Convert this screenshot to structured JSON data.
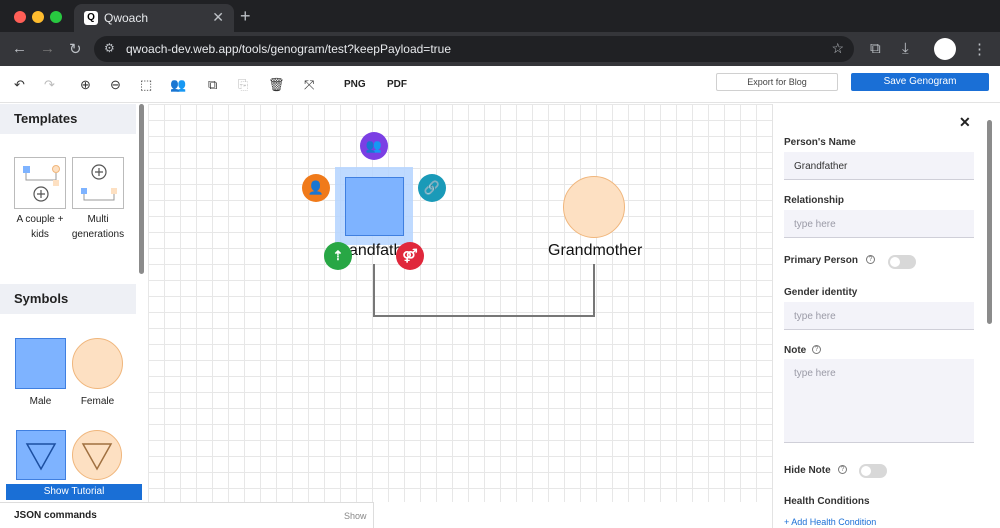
{
  "browser": {
    "tab_title": "Qwoach",
    "tab_favicon": "Q",
    "url": "qwoach-dev.web.app/tools/genogram/test?keepPayload=true"
  },
  "toolbar": {
    "png_label": "PNG",
    "pdf_label": "PDF",
    "export_blog_label": "Export for Blog",
    "save_label": "Save Genogram"
  },
  "left_panel": {
    "templates_heading": "Templates",
    "templates": [
      {
        "label_line1": "A couple +",
        "label_line2": "kids"
      },
      {
        "label_line1": "Multi",
        "label_line2": "generations"
      }
    ],
    "symbols_heading": "Symbols",
    "symbols": [
      {
        "label": "Male"
      },
      {
        "label": "Female"
      }
    ],
    "show_tutorial_label": "Show Tutorial",
    "json_commands_label": "JSON commands",
    "json_show_label": "Show"
  },
  "canvas": {
    "nodes": [
      {
        "label": "Grandfather",
        "visible_label": "andfath",
        "shape": "square"
      },
      {
        "label": "Grandmother",
        "shape": "circle"
      }
    ]
  },
  "right_panel": {
    "name_label": "Person's Name",
    "name_value": "Grandfather",
    "relationship_label": "Relationship",
    "relationship_placeholder": "type here",
    "primary_label": "Primary Person",
    "gender_label": "Gender identity",
    "gender_placeholder": "type here",
    "note_label": "Note",
    "note_placeholder": "type here",
    "hide_note_label": "Hide Note",
    "health_label": "Health Conditions",
    "add_health_label": "+ Add Health Condition"
  },
  "colors": {
    "male_fill": "#7eb3ff",
    "male_stroke": "#3f7fe0",
    "female_fill": "#fde0c2",
    "female_stroke": "#f0b67c",
    "accent": "#1a6fd6"
  }
}
